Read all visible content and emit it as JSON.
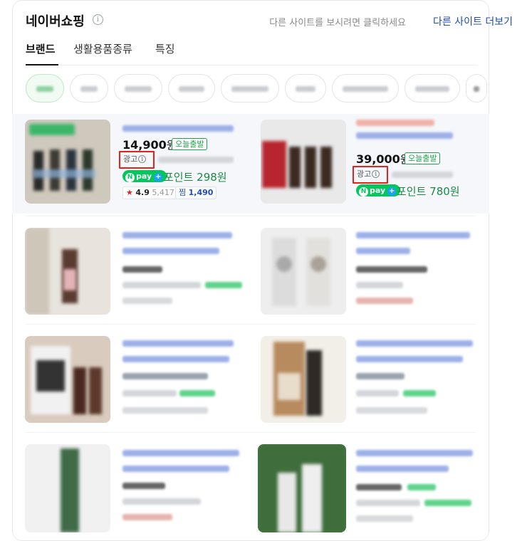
{
  "header": {
    "title": "네이버쇼핑",
    "info_icon": "info-icon",
    "hint": "다른 사이트를 보시려면 클릭하세요",
    "more_link": "다른 사이트 더보기"
  },
  "tabs": [
    {
      "label": "브랜드",
      "active": true
    },
    {
      "label": "생활용품종류",
      "active": false
    },
    {
      "label": "특징",
      "active": false
    }
  ],
  "featured": [
    {
      "price": "14,900",
      "won": "원",
      "fast_badge": "오늘출발",
      "ad_label": "광고",
      "npay_n": "N",
      "npay_text": "pay",
      "npay_plus": "+",
      "point": "포인트 298원",
      "rating_star": "★",
      "rating": "4.9",
      "review_count": "5,417",
      "zzim_label": "찜",
      "zzim_count": "1,490"
    },
    {
      "price": "39,000",
      "won": "원",
      "fast_badge": "오늘출발",
      "ad_label": "광고",
      "npay_n": "N",
      "npay_text": "pay",
      "npay_plus": "+",
      "point": "포인트 780원"
    }
  ],
  "colors": {
    "accent_green": "#03c75a",
    "link_blue": "#1f4bb8",
    "highlight_red": "#e8201c"
  }
}
